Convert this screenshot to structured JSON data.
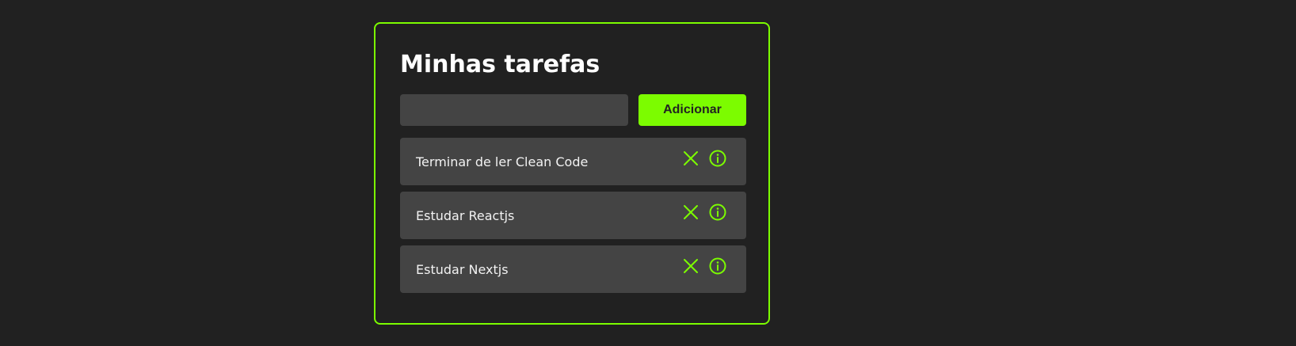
{
  "header": {
    "title": "Minhas tarefas"
  },
  "form": {
    "input_value": "",
    "input_placeholder": "",
    "add_button_label": "Adicionar"
  },
  "tasks": [
    {
      "title": "Terminar de ler Clean Code",
      "remove_icon": "close-icon",
      "info_icon": "info-icon"
    },
    {
      "title": "Estudar Reactjs",
      "remove_icon": "close-icon",
      "info_icon": "info-icon"
    },
    {
      "title": "Estudar Nextjs",
      "remove_icon": "close-icon",
      "info_icon": "info-icon"
    }
  ],
  "colors": {
    "accent": "#7cfc00",
    "background": "#212121",
    "surface": "#444444",
    "text": "#ffffff"
  }
}
